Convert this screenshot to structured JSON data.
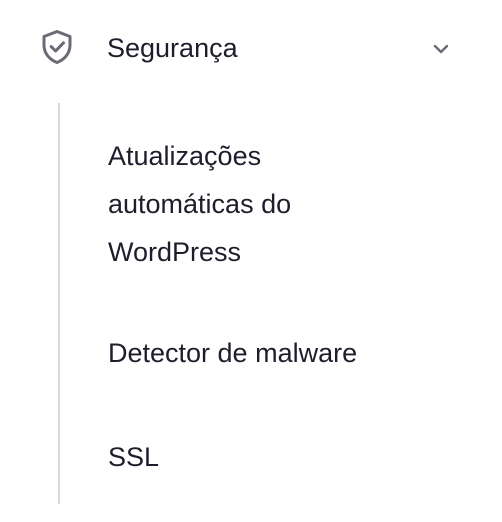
{
  "section": {
    "title": "Segurança",
    "icon": "shield-check-icon",
    "expand_icon": "chevron-down-icon",
    "expanded": true
  },
  "submenu": {
    "items": [
      {
        "label": "Atualizações automáticas do WordPress"
      },
      {
        "label": "Detector de malware"
      },
      {
        "label": "SSL"
      }
    ]
  },
  "colors": {
    "text": "#1f1d2b",
    "icon": "#6b6a75",
    "divider": "#d8d8de",
    "background": "#ffffff"
  }
}
